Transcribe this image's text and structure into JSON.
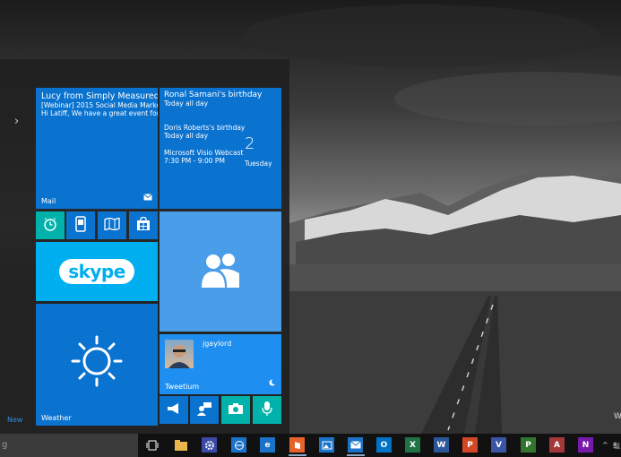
{
  "start_menu": {
    "expand_glyph": "›",
    "new_label": "New"
  },
  "tiles": {
    "mail": {
      "sender": "Lucy from Simply Measured",
      "subject": "[Webinar] 2015 Social Media Marketin",
      "preview": "Hi Latiff, We have a great event for yo",
      "label": "Mail"
    },
    "calendar": {
      "event1_title": "Ronal Samani's birthday",
      "event1_time": "Today all day",
      "event2_title": "Doris Roberts's birthday",
      "event2_time": "Today all day",
      "event3_title": "Microsoft Visio Webcast",
      "event3_time": "7:30 PM - 9:00 PM",
      "date_number": "2",
      "day_name": "Tuesday"
    },
    "skype": {
      "logo_text": "skype"
    },
    "weather": {
      "label": "Weather"
    },
    "tweetium": {
      "username": "jgaylord",
      "label": "Tweetium"
    }
  },
  "taskbar": {
    "search_text": "g",
    "apps": [
      "task-view",
      "file-explorer",
      "settings",
      "network",
      "internet-explorer",
      "office-hub",
      "photos",
      "mail",
      "outlook",
      "excel",
      "word",
      "powerpoint",
      "visio",
      "project",
      "access",
      "onenote"
    ],
    "letters": {
      "outlook": "O",
      "excel": "X",
      "word": "W",
      "powerpoint": "P",
      "visio": "V",
      "project": "P",
      "access": "A",
      "onenote": "N"
    },
    "colors": {
      "outlook": "#0072c6",
      "excel": "#217346",
      "word": "#2b579a",
      "powerpoint": "#d24726",
      "visio": "#3955a3",
      "project": "#31752f",
      "access": "#a4373a",
      "onenote": "#7719aa"
    },
    "tray_glyph": "^",
    "tray_text": "転"
  },
  "desktop": {
    "watermark": "W"
  }
}
